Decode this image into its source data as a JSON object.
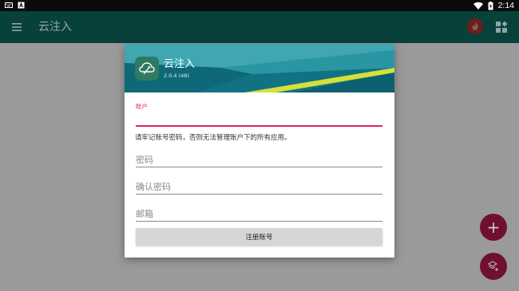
{
  "status_bar": {
    "time": "2:14",
    "left_icons": [
      "keyboard-icon",
      "a-notification-icon"
    ],
    "right_icons": [
      "wifi-icon",
      "battery-icon"
    ]
  },
  "app_bar": {
    "title": "云注入",
    "menu_icon": "menu-icon",
    "action_icons": [
      "fire-icon",
      "apps-grid-icon"
    ]
  },
  "dialog": {
    "app_name": "云注入",
    "app_version": "2.0.4 (48)",
    "account_label": "账户",
    "account_value": "",
    "hint": "请牢记账号密码，否则无法管理账户下的所有应用。",
    "password_placeholder": "密码",
    "confirm_password_placeholder": "确认密码",
    "email_placeholder": "邮箱",
    "register_button": "注册账号"
  },
  "fabs": {
    "add_label": "+",
    "add_icon": "plus-icon",
    "layer_icon": "layers-add-icon"
  },
  "colors": {
    "accent": "#e0245e",
    "app_bar": "#08403c",
    "header": "#0f7080",
    "fab": "#6f1032",
    "button": "#d6d6d6"
  }
}
